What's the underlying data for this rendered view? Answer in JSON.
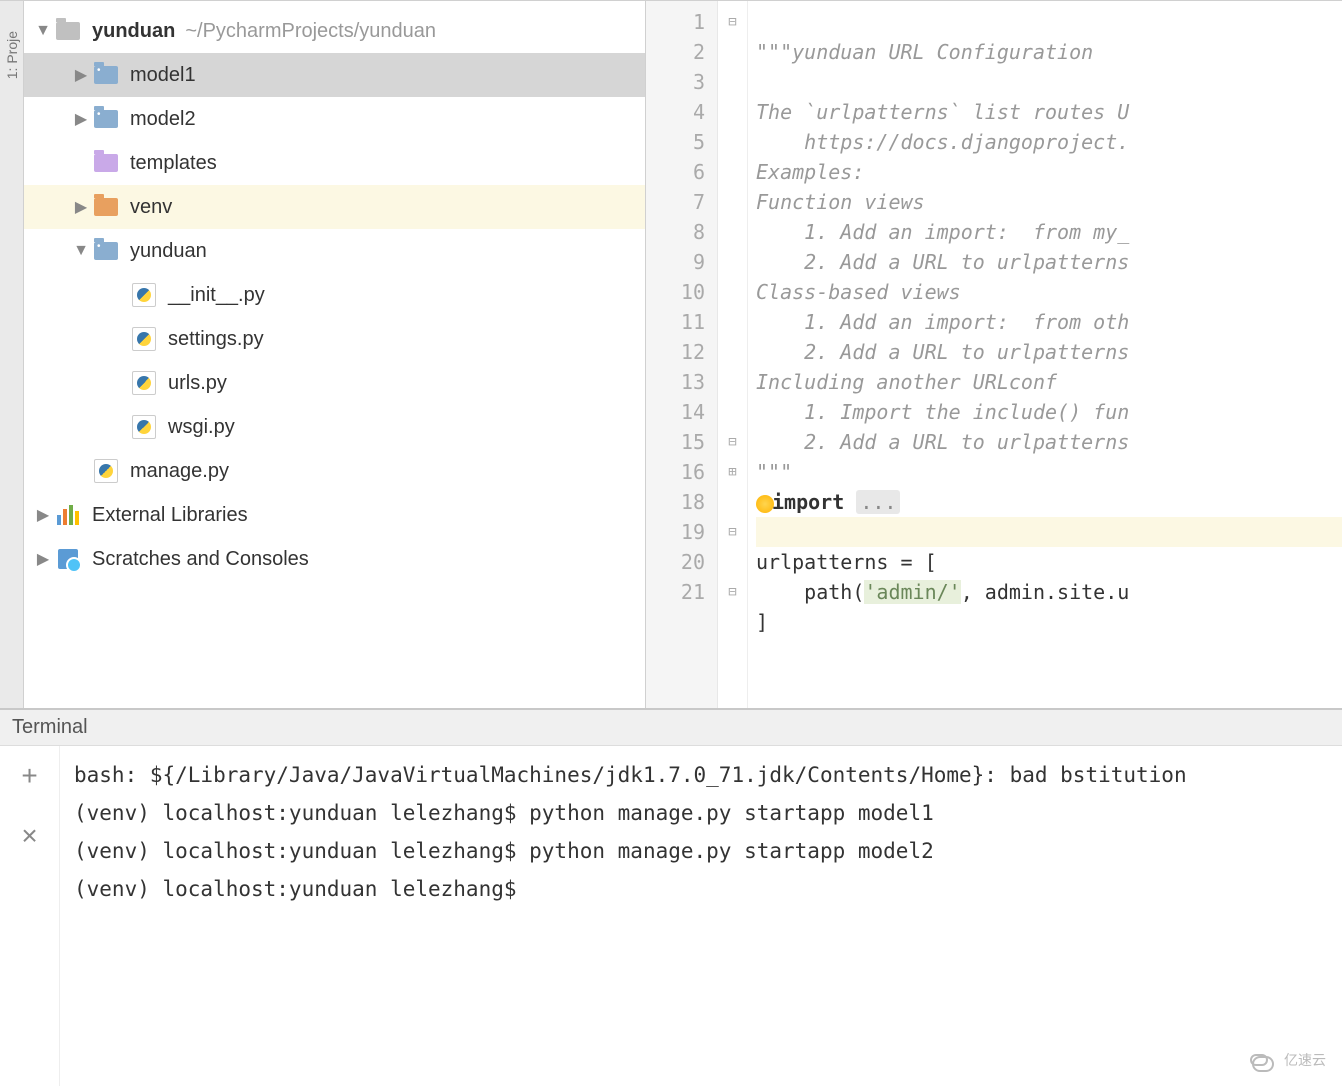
{
  "leftGutter": {
    "label": "1: Proje"
  },
  "projectTree": {
    "root": {
      "name": "yunduan",
      "path": "~/PycharmProjects/yunduan"
    },
    "items": [
      {
        "label": "model1",
        "type": "dir",
        "indent": 1,
        "arrow": "▶",
        "selected": true
      },
      {
        "label": "model2",
        "type": "dir",
        "indent": 1,
        "arrow": "▶"
      },
      {
        "label": "templates",
        "type": "purple",
        "indent": 1,
        "arrow": ""
      },
      {
        "label": "venv",
        "type": "orange",
        "indent": 1,
        "arrow": "▶",
        "highlight": true
      },
      {
        "label": "yunduan",
        "type": "dir",
        "indent": 1,
        "arrow": "▼"
      },
      {
        "label": "__init__.py",
        "type": "py",
        "indent": 2,
        "arrow": ""
      },
      {
        "label": "settings.py",
        "type": "py",
        "indent": 2,
        "arrow": ""
      },
      {
        "label": "urls.py",
        "type": "py",
        "indent": 2,
        "arrow": ""
      },
      {
        "label": "wsgi.py",
        "type": "py",
        "indent": 2,
        "arrow": ""
      },
      {
        "label": "manage.py",
        "type": "py",
        "indent": 1,
        "arrow": ""
      }
    ],
    "extLibs": "External Libraries",
    "scratches": "Scratches and Consoles"
  },
  "editor": {
    "gutterLines": [
      "1",
      "2",
      "3",
      "4",
      "5",
      "6",
      "7",
      "8",
      "9",
      "10",
      "11",
      "12",
      "13",
      "14",
      "15",
      "16",
      "18",
      "19",
      "20",
      "21"
    ],
    "foldMarks": [
      "⊟",
      "",
      "",
      "",
      "",
      "",
      "",
      "",
      "",
      "",
      "",
      "",
      "",
      "",
      "⊟",
      "⊞",
      "",
      "⊟",
      "",
      "⊟"
    ],
    "code": {
      "l1a": "\"\"\"",
      "l1b": "yunduan URL Configuration",
      "l2": "",
      "l3": "The `urlpatterns` list routes U",
      "l4": "    https://docs.djangoproject.",
      "l5": "Examples:",
      "l6": "Function views",
      "l7": "    1. Add an import:  from my_",
      "l8": "    2. Add a URL to urlpatterns",
      "l9": "Class-based views",
      "l10": "    1. Add an import:  from oth",
      "l11": "    2. Add a URL to urlpatterns",
      "l12": "Including another URLconf",
      "l13": "    1. Import the include() fun",
      "l14": "    2. Add a URL to urlpatterns",
      "l15": "\"\"\"",
      "l16a": "im",
      "l16b": "port ",
      "l16c": "...",
      "l19": "urlpatterns = [",
      "l20a": "    path(",
      "l20b": "'admin/'",
      "l20c": ", admin.site.u",
      "l21": "]"
    }
  },
  "terminal": {
    "title": "Terminal",
    "lines": [
      "bash: ${/Library/Java/JavaVirtualMachines/jdk1.7.0_71.jdk/Contents/Home}: bad bstitution",
      "(venv) localhost:yunduan lelezhang$ python manage.py startapp model1",
      "(venv) localhost:yunduan lelezhang$ python manage.py startapp model2",
      "(venv) localhost:yunduan lelezhang$ "
    ]
  },
  "watermark": "亿速云"
}
